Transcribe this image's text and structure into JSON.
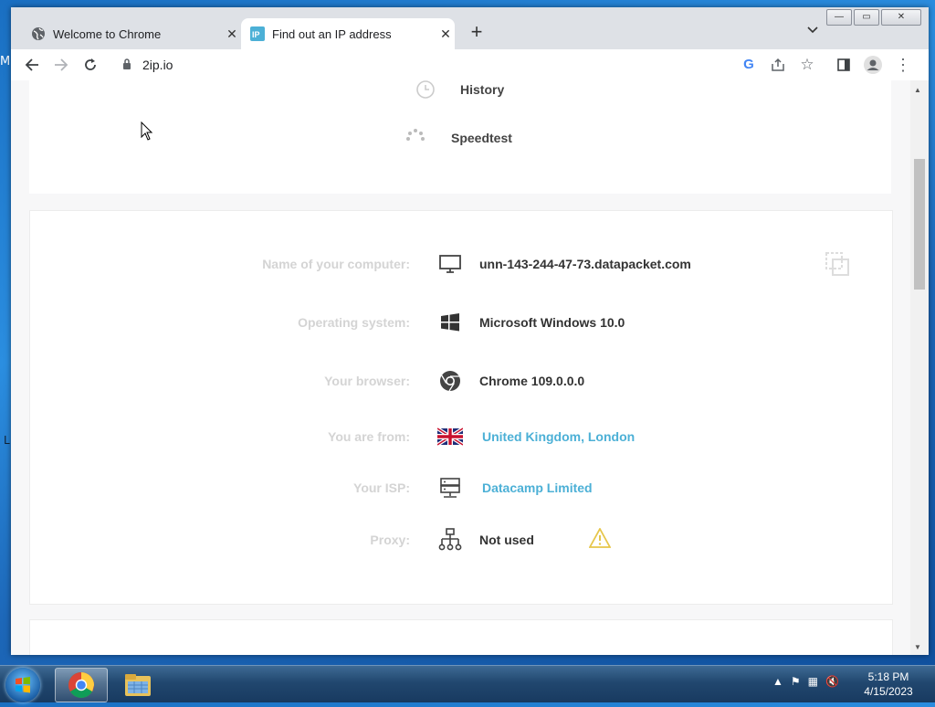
{
  "tabs": [
    {
      "title": "Welcome to Chrome",
      "active": false,
      "favicon": "globe-icon"
    },
    {
      "title": "Find out an IP address",
      "active": true,
      "favicon": "ip-favicon"
    }
  ],
  "toolbar": {
    "url": "2ip.io"
  },
  "menu": [
    {
      "label": "History",
      "icon": "clock-icon"
    },
    {
      "label": "Speedtest",
      "icon": "spinner-icon"
    }
  ],
  "info": {
    "computer": {
      "label": "Name of your computer:",
      "value": "unn-143-244-47-73.datapacket.com"
    },
    "os": {
      "label": "Operating system:",
      "value": "Microsoft Windows 10.0"
    },
    "browser": {
      "label": "Your browser:",
      "value": "Chrome 109.0.0.0"
    },
    "location": {
      "label": "You are from:",
      "value": "United Kingdom, London"
    },
    "isp": {
      "label": "Your ISP:",
      "value": "Datacamp Limited"
    },
    "proxy": {
      "label": "Proxy:",
      "value": "Not used"
    }
  },
  "desktop": {
    "edge_letter": "M",
    "edge_letter2": "L"
  },
  "taskbar": {
    "time": "5:18 PM",
    "date": "4/15/2023"
  },
  "colors": {
    "link": "#4cb0d6",
    "warning": "#e6c64a",
    "flag_blue": "#1e2d78",
    "flag_red": "#c8102e"
  }
}
